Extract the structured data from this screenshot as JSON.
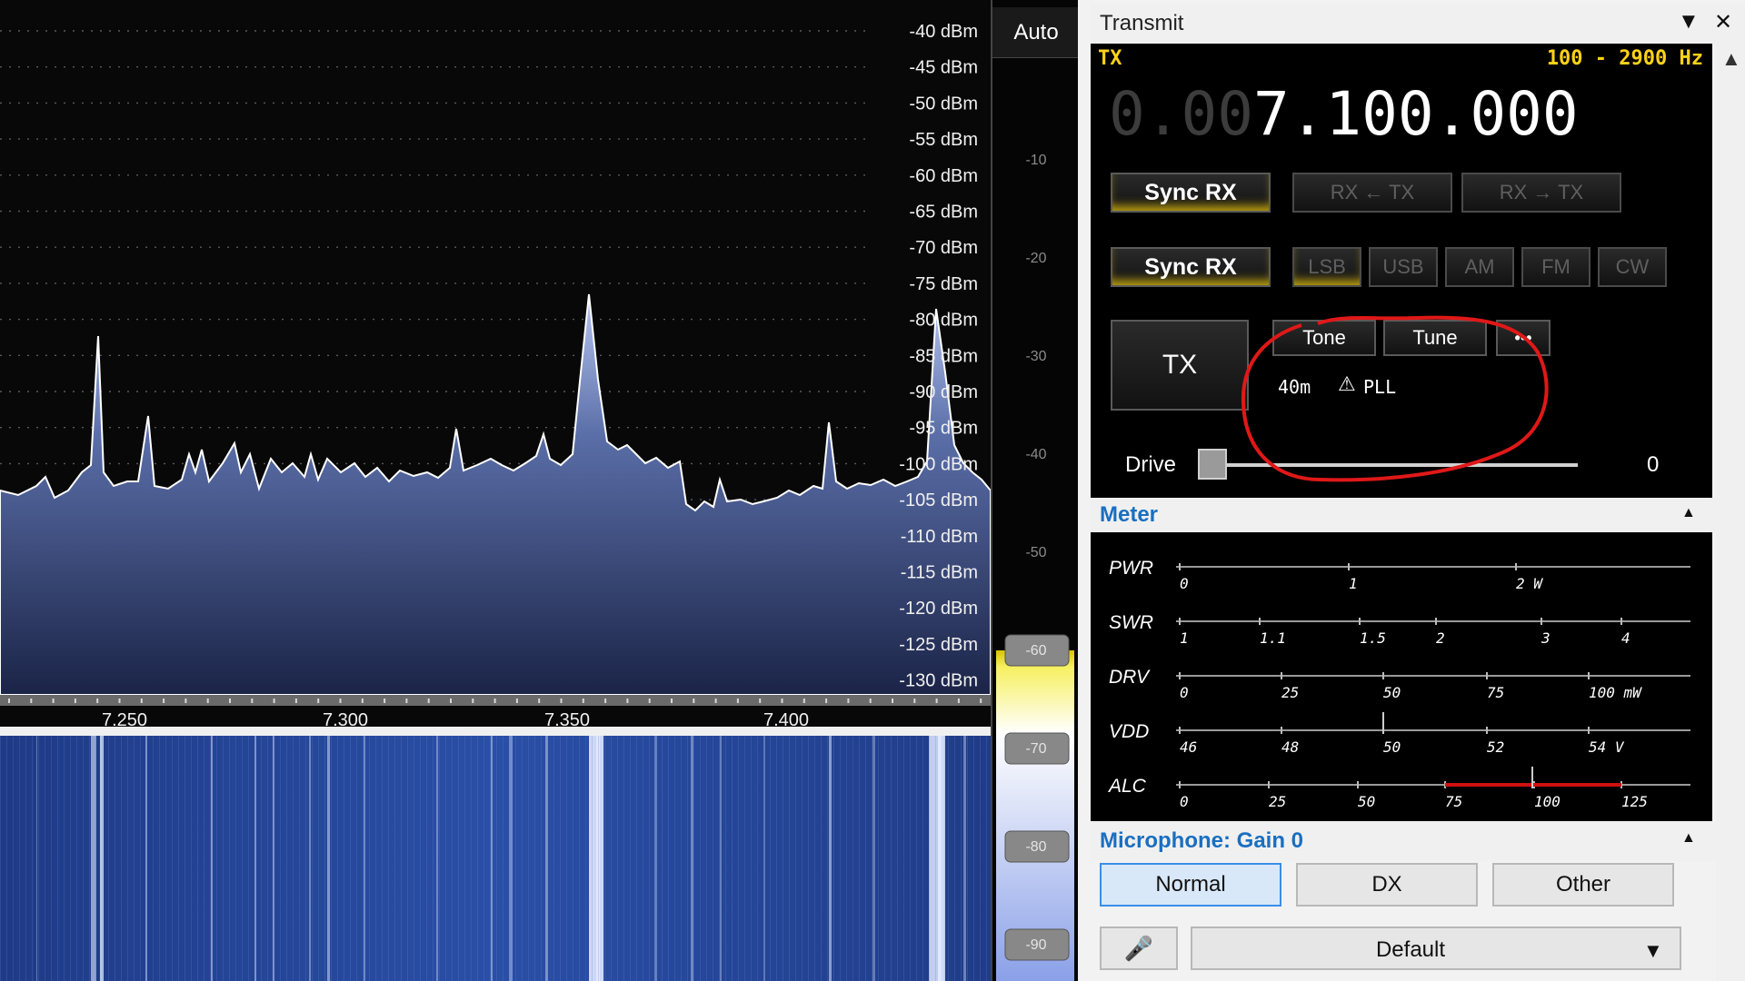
{
  "spectrum": {
    "db_labels": [
      "-40 dBm",
      "-45 dBm",
      "-50 dBm",
      "-55 dBm",
      "-60 dBm",
      "-65 dBm",
      "-70 dBm",
      "-75 dBm",
      "-80 dBm",
      "-85 dBm",
      "-90 dBm",
      "-95 dBm",
      "-100 dBm",
      "-105 dBm",
      "-110 dBm",
      "-115 dBm",
      "-120 dBm",
      "-125 dBm",
      "-130 dBm"
    ],
    "freq_labels": [
      "7.250",
      "7.300",
      "7.350",
      "7.400"
    ],
    "fill_color": "#7f93d0",
    "waterfall_color": "#213f8a"
  },
  "side_scale": {
    "auto_label": "Auto",
    "ticks": [
      "-10",
      "-20",
      "-30",
      "-40",
      "-50",
      "-60",
      "-70",
      "-80",
      "-90"
    ]
  },
  "transmit": {
    "title": "Transmit",
    "tx_label": "TX",
    "filter": "100 - 2900 Hz",
    "freq_dim": "0.00",
    "freq_bright": "7.100.000",
    "sync_rx_1": "Sync RX",
    "rx_to_tx": "RX ← TX",
    "rx_from_tx": "RX → TX",
    "sync_rx_2": "Sync RX",
    "modes": [
      "LSB",
      "USB",
      "AM",
      "FM",
      "CW"
    ],
    "tx_button": "TX",
    "tone": "Tone",
    "tune": "Tune",
    "more": "•••",
    "band": "40m",
    "pll": "PLL",
    "drive_label": "Drive",
    "drive_value": "0",
    "drive_level": 0
  },
  "meter": {
    "title": "Meter",
    "rows": [
      {
        "name": "PWR",
        "labels": [
          "0",
          "1",
          "2 W"
        ]
      },
      {
        "name": "SWR",
        "labels": [
          "1",
          "1.1",
          "1.5",
          "2",
          "3",
          "4"
        ]
      },
      {
        "name": "DRV",
        "labels": [
          "0",
          "25",
          "50",
          "75",
          "100 mW"
        ]
      },
      {
        "name": "VDD",
        "labels": [
          "46",
          "48",
          "50",
          "52",
          "54 V"
        ]
      },
      {
        "name": "ALC",
        "labels": [
          "0",
          "25",
          "50",
          "75",
          "100",
          "125"
        ]
      }
    ]
  },
  "microphone": {
    "title": "Microphone: Gain 0",
    "profiles": [
      "Normal",
      "DX",
      "Other"
    ],
    "selected": "Normal",
    "preset": "Default"
  }
}
